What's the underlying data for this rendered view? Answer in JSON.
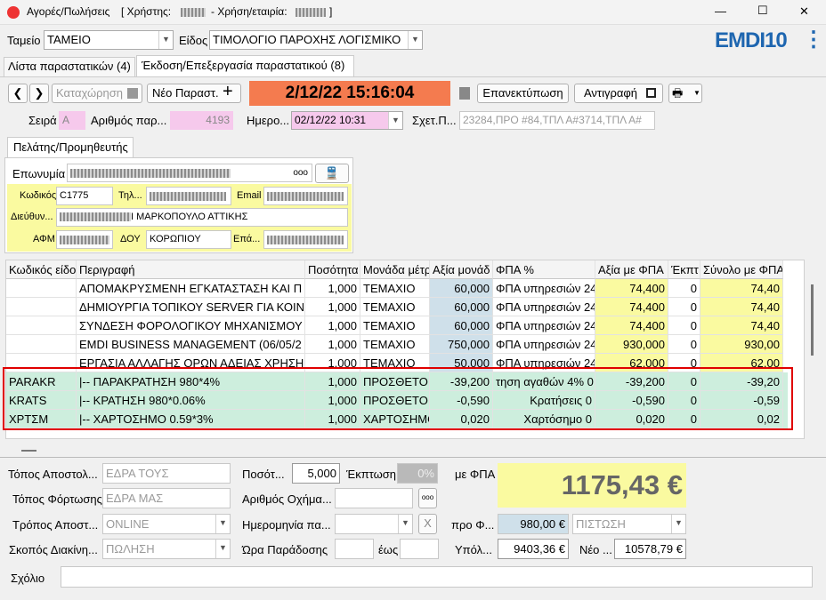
{
  "titlebar": {
    "title": "Αγορές/Πωλήσεις",
    "user_label": "[ Χρήστης:",
    "year_label": "- Χρήση/εταιρία:",
    "end": "]",
    "minimize": "—",
    "maximize": "☐",
    "close": "✕"
  },
  "top": {
    "tameio_label": "Ταμείο",
    "tameio_value": "ΤΑΜΕΙΟ",
    "eidos_label": "Είδος",
    "eidos_value": "ΤΙΜΟΛΟΓΙΟ ΠΑΡΟΧΗΣ ΛΟΓΙΣΜΙΚΟ",
    "logo": "EMDI10",
    "menu_dots": "⋮"
  },
  "tabs": [
    {
      "label": "Λίστα παραστατικών (4)"
    },
    {
      "label": "Έκδοση/Επεξεργασία παραστατικού (8)"
    }
  ],
  "toolbar": {
    "back": "❮",
    "forward": "❯",
    "save": "Καταχώρηση",
    "new": "Νέο Παραστ.",
    "datetime": "2/12/22 15:16:04",
    "reprint": "Επανεκτύπωση",
    "copy": "Αντιγραφή"
  },
  "header": {
    "seira_label": "Σειρά",
    "seira_value": "A",
    "arithmos_label": "Αριθμός παρ...",
    "arithmos_value": "4193",
    "date_label": "Ημερο...",
    "date_value": "02/12/22 10:31",
    "sxet_label": "Σχετ.Π...",
    "sxet_value": "23284,ΠΡΟ #84,ΤΠΛ Α#3714,ΤΠΛ Α#"
  },
  "customer": {
    "tab": "Πελάτης/Προμηθευτής",
    "name_label": "Επωνυμία",
    "code_label": "Κωδικός",
    "code_value": "C1775",
    "phone_label": "Τηλ...",
    "email_label": "Email",
    "address_label": "Διεύθυν...",
    "address_value": "Ι ΜΑΡΚΟΠΟΥΛΟ ΑΤΤΙΚΗΣ",
    "afm_label": "ΑΦΜ",
    "doy_label": "ΔΟΥ",
    "doy_value": "ΚΟΡΩΠΙΟΥ",
    "epa_label": "Επά...",
    "more": "ooo"
  },
  "table": {
    "headers": [
      "Κωδικός είδο",
      "Περιγραφή",
      "Ποσότητα",
      "Μονάδα μέτρ",
      "Αξία μονάδ",
      "ΦΠΑ %",
      "Αξία με ΦΠΑ",
      "Έκπτ",
      "Σύνολο με ΦΠΑ"
    ],
    "rows": [
      [
        "",
        "ΑΠΟΜΑΚΡΥΣΜΕΝΗ ΕΓΚΑΤΑΣΤΑΣΗ ΚΑΙ Π",
        "1,000",
        "ΤΕΜΑΧΙΟ",
        "60,000",
        "ΦΠΑ υπηρεσιών 24",
        "74,400",
        "0",
        "74,40"
      ],
      [
        "",
        "ΔΗΜΙΟΥΡΓΙΑ ΤΟΠΙΚΟΥ SERVER ΓΙΑ ΚΟΙΝ",
        "1,000",
        "ΤΕΜΑΧΙΟ",
        "60,000",
        "ΦΠΑ υπηρεσιών 24",
        "74,400",
        "0",
        "74,40"
      ],
      [
        "",
        "ΣΥΝΔΕΣΗ ΦΟΡΟΛΟΓΙΚΟΥ ΜΗΧΑΝΙΣΜΟΥ",
        "1,000",
        "ΤΕΜΑΧΙΟ",
        "60,000",
        "ΦΠΑ υπηρεσιών 24",
        "74,400",
        "0",
        "74,40"
      ],
      [
        "",
        "EMDI BUSINESS MANAGEMENT (06/05/2",
        "1,000",
        "ΤΕΜΑΧΙΟ",
        "750,000",
        "ΦΠΑ υπηρεσιών 24",
        "930,000",
        "0",
        "930,00"
      ],
      [
        "",
        "ΕΡΓΑΣΙΑ ΑΛΛΑΓΗΣ ΟΡΩΝ ΑΔΕΙΑΣ ΧΡΗΣΗ",
        "1,000",
        "ΤΕΜΑΧΙΟ",
        "50,000",
        "ΦΠΑ υπηρεσιών 24",
        "62,000",
        "0",
        "62,00"
      ],
      [
        "PARAKR",
        "|-- ΠΑΡΑΚΡΑΤΗΣΗ 980*4%",
        "1,000",
        "ΠΡΟΣΘΕΤΟ",
        "-39,200",
        "τηση αγαθών 4% 0",
        "-39,200",
        "0",
        "-39,20"
      ],
      [
        "KRATS",
        "|-- ΚΡΑΤΗΣΗ 980*0.06%",
        "1,000",
        "ΠΡΟΣΘΕΤΟ",
        "-0,590",
        "Κρατήσεις 0",
        "-0,590",
        "0",
        "-0,59"
      ],
      [
        "ΧΡΤΣΜ",
        "|-- ΧΑΡΤΟΣΗΜΟ 0.59*3%",
        "1,000",
        "ΧΑΡΤΟΣΗΜΟ",
        "0,020",
        "Χαρτόσημο 0",
        "0,020",
        "0",
        "0,02"
      ]
    ]
  },
  "footer": {
    "topos_apost_label": "Τόπος Αποστολ...",
    "topos_apost_value": "ΕΔΡΑ ΤΟΥΣ",
    "topos_fort_label": "Τόπος Φόρτωσης",
    "topos_fort_value": "ΕΔΡΑ ΜΑΣ",
    "tropos_label": "Τρόπος Αποστ...",
    "tropos_value": "ONLINE",
    "skopos_label": "Σκοπός Διακίνη...",
    "skopos_value": "ΠΩΛΗΣΗ",
    "posot_label": "Ποσότ...",
    "posot_value": "5,000",
    "ekptosi_label": "Έκπτωση",
    "ekptosi_value": "0%",
    "oxima_label": "Αριθμός Οχήμα...",
    "hmer_label": "Ημερομηνία πα...",
    "x_btn": "X",
    "ora_label": "Ώρα Παράδοσης",
    "eos_label": "έως",
    "me_fpa_label": "με ΦΠΑ",
    "total": "1175,43 €",
    "pro_label": "προ Φ...",
    "pro_value": "980,00 €",
    "payment_value": "ΠΙΣΤΩΣΗ",
    "ypol_label": "Υπόλ...",
    "ypol_value": "9403,36 €",
    "neo_label": "Νέο ...",
    "neo_value": "10578,79 €",
    "comment_label": "Σχόλιο",
    "more": "ooo"
  },
  "colors": {
    "datetime_bg": "#f47b4f",
    "highlight_border": "#e00000",
    "yellow": "#fafaa0",
    "blue": "#cfe0ea",
    "green": "#cdeedd",
    "logo": "#1e66b0"
  }
}
